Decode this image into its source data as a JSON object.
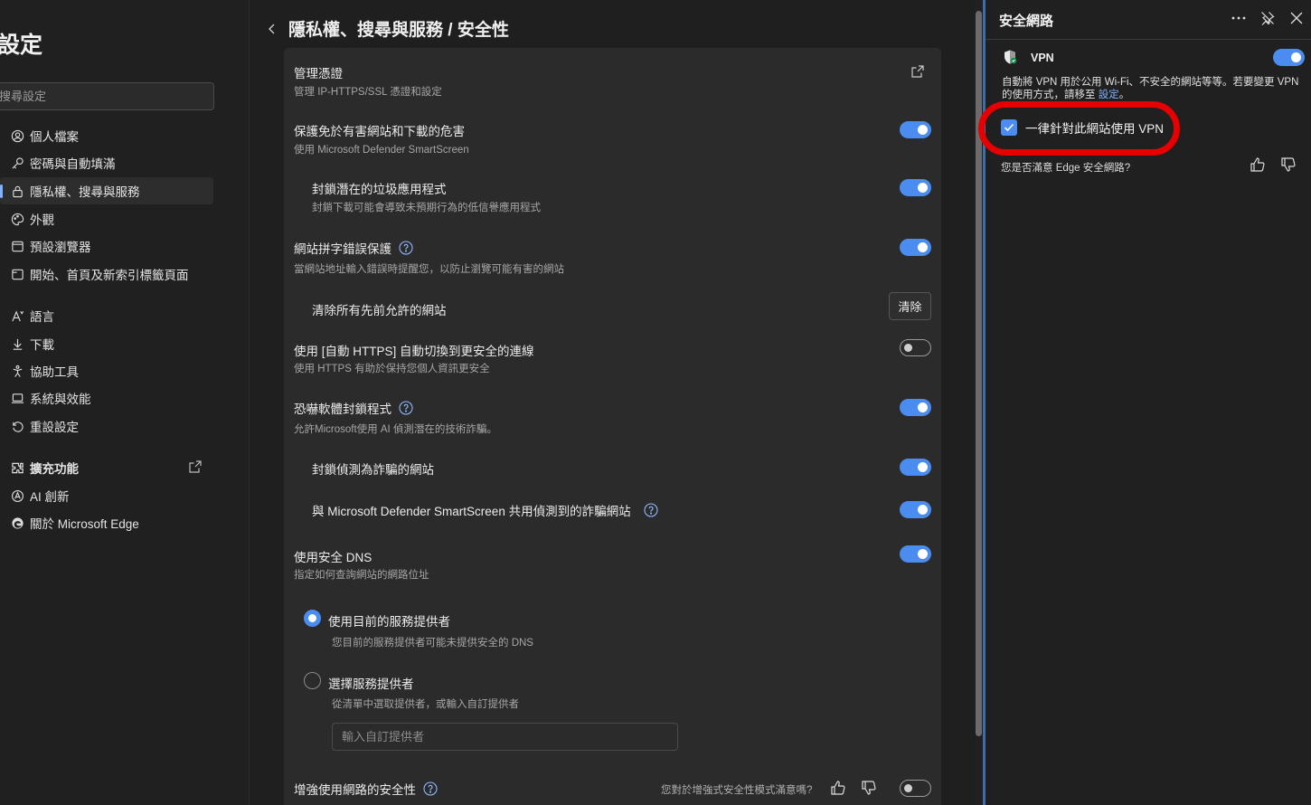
{
  "sidebar": {
    "title": "設定",
    "search_placeholder": "搜尋設定",
    "items": [
      {
        "label": "個人檔案",
        "icon": "profile-icon"
      },
      {
        "label": "密碼與自動填滿",
        "icon": "key-icon"
      },
      {
        "label": "隱私權、搜尋與服務",
        "icon": "lock-icon",
        "active": true
      },
      {
        "label": "外觀",
        "icon": "palette-icon"
      },
      {
        "label": "預設瀏覽器",
        "icon": "browser-icon"
      },
      {
        "label": "開始、首頁及新索引標籤頁面",
        "icon": "home-icon"
      },
      {
        "label": "語言",
        "icon": "language-icon"
      },
      {
        "label": "下載",
        "icon": "download-icon"
      },
      {
        "label": "協助工具",
        "icon": "accessibility-icon"
      },
      {
        "label": "系統與效能",
        "icon": "laptop-icon"
      },
      {
        "label": "重設設定",
        "icon": "reset-icon"
      },
      {
        "label": "擴充功能",
        "icon": "extension-icon"
      },
      {
        "label": "AI 創新",
        "icon": "ai-icon"
      },
      {
        "label": "關於 Microsoft Edge",
        "icon": "edge-icon"
      }
    ]
  },
  "main": {
    "breadcrumb": "隱私權、搜尋與服務 / 安全性",
    "rows": {
      "certs": {
        "title": "管理憑證",
        "sub": "管理 IP-HTTPS/SSL 憑證和設定"
      },
      "smartscreen": {
        "title": "保護免於有害網站和下載的危害",
        "sub": "使用 Microsoft Defender SmartScreen",
        "on": true
      },
      "pua": {
        "title": "封鎖潛在的垃圾應用程式",
        "sub": "封鎖下載可能會導致未預期行為的低信譽應用程式",
        "on": true
      },
      "typo": {
        "title": "網站拼字錯誤保護",
        "sub": "當網站地址輸入錯誤時提醒您，以防止瀏覽可能有害的網站",
        "on": true
      },
      "clear": {
        "title": "清除所有先前允許的網站",
        "button": "清除"
      },
      "https": {
        "title": "使用 [自動 HTTPS] 自動切換到更安全的連線",
        "sub": "使用 HTTPS 有助於保持您個人資訊更安全",
        "on": false
      },
      "scareware": {
        "title": "恐嚇軟體封鎖程式",
        "sub": "允許Microsoft使用 AI 偵測潛在的技術詐騙。",
        "on": true
      },
      "block_scam": {
        "title": "封鎖偵測為詐騙的網站",
        "on": true
      },
      "share_scam": {
        "title": "與 Microsoft Defender SmartScreen 共用偵測到的詐騙網站",
        "on": true
      },
      "dns": {
        "title": "使用安全 DNS",
        "sub": "指定如何查詢網站的網路位址",
        "on": true
      },
      "dns_current": {
        "title": "使用目前的服務提供者",
        "sub": "您目前的服務提供者可能未提供安全的 DNS",
        "selected": true
      },
      "dns_choose": {
        "title": "選擇服務提供者",
        "sub": "從清單中選取提供者，或輸入自訂提供者",
        "selected": false,
        "placeholder": "輸入自訂提供者"
      },
      "enhanced": {
        "title": "增強使用網路的安全性",
        "feedback": "您對於增強式安全性模式滿意嗎?",
        "on": false
      }
    }
  },
  "panel": {
    "title": "安全網路",
    "vpn_label": "VPN",
    "vpn_on": true,
    "vpn_desc": "自動將 VPN 用於公用 Wi-Fi、不安全的網站等等。若要變更 VPN 的使用方式，請移至",
    "vpn_link": "設定",
    "always_vpn": "一律針對此網站使用 VPN",
    "always_vpn_checked": true,
    "feedback": "您是否滿意 Edge 安全網路?"
  },
  "colors": {
    "accent": "#4a8cf0",
    "highlight": "#e60000",
    "link": "#7fb2ff"
  }
}
